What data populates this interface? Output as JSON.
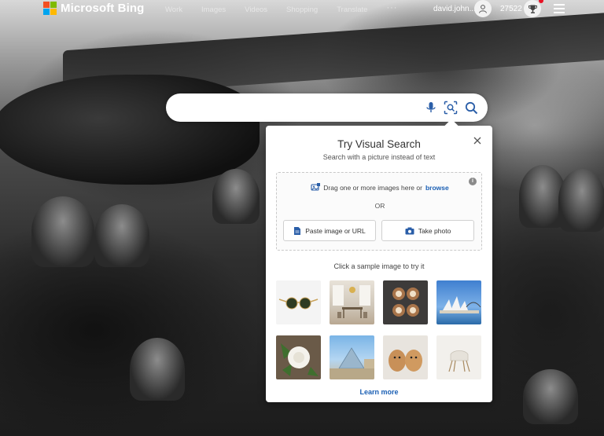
{
  "header": {
    "brand": "Microsoft Bing",
    "nav": [
      "Work",
      "Images",
      "Videos",
      "Shopping",
      "Translate"
    ],
    "more": "···",
    "username": "david.john...",
    "points": "27522"
  },
  "search": {
    "value": "",
    "placeholder": "",
    "icons": [
      "microphone-icon",
      "visual-search-icon",
      "search-icon"
    ]
  },
  "visual_search": {
    "title": "Try Visual Search",
    "subtitle": "Search with a picture instead of text",
    "drag_text": "Drag one or more images here or",
    "browse": "browse",
    "or": "OR",
    "paste_label": "Paste image or URL",
    "photo_label": "Take photo",
    "sample_label": "Click a sample image to try it",
    "samples": [
      "sunglasses",
      "dining room",
      "latte art",
      "sydney opera house",
      "white flower",
      "louvre pyramid",
      "puppies",
      "chair"
    ],
    "learn_more": "Learn more"
  },
  "colors": {
    "accent": "#1a5fb4",
    "ms_red": "#f25022",
    "ms_green": "#7fba00",
    "ms_blue": "#00a4ef",
    "ms_yellow": "#ffb900",
    "notification": "#e81123"
  }
}
